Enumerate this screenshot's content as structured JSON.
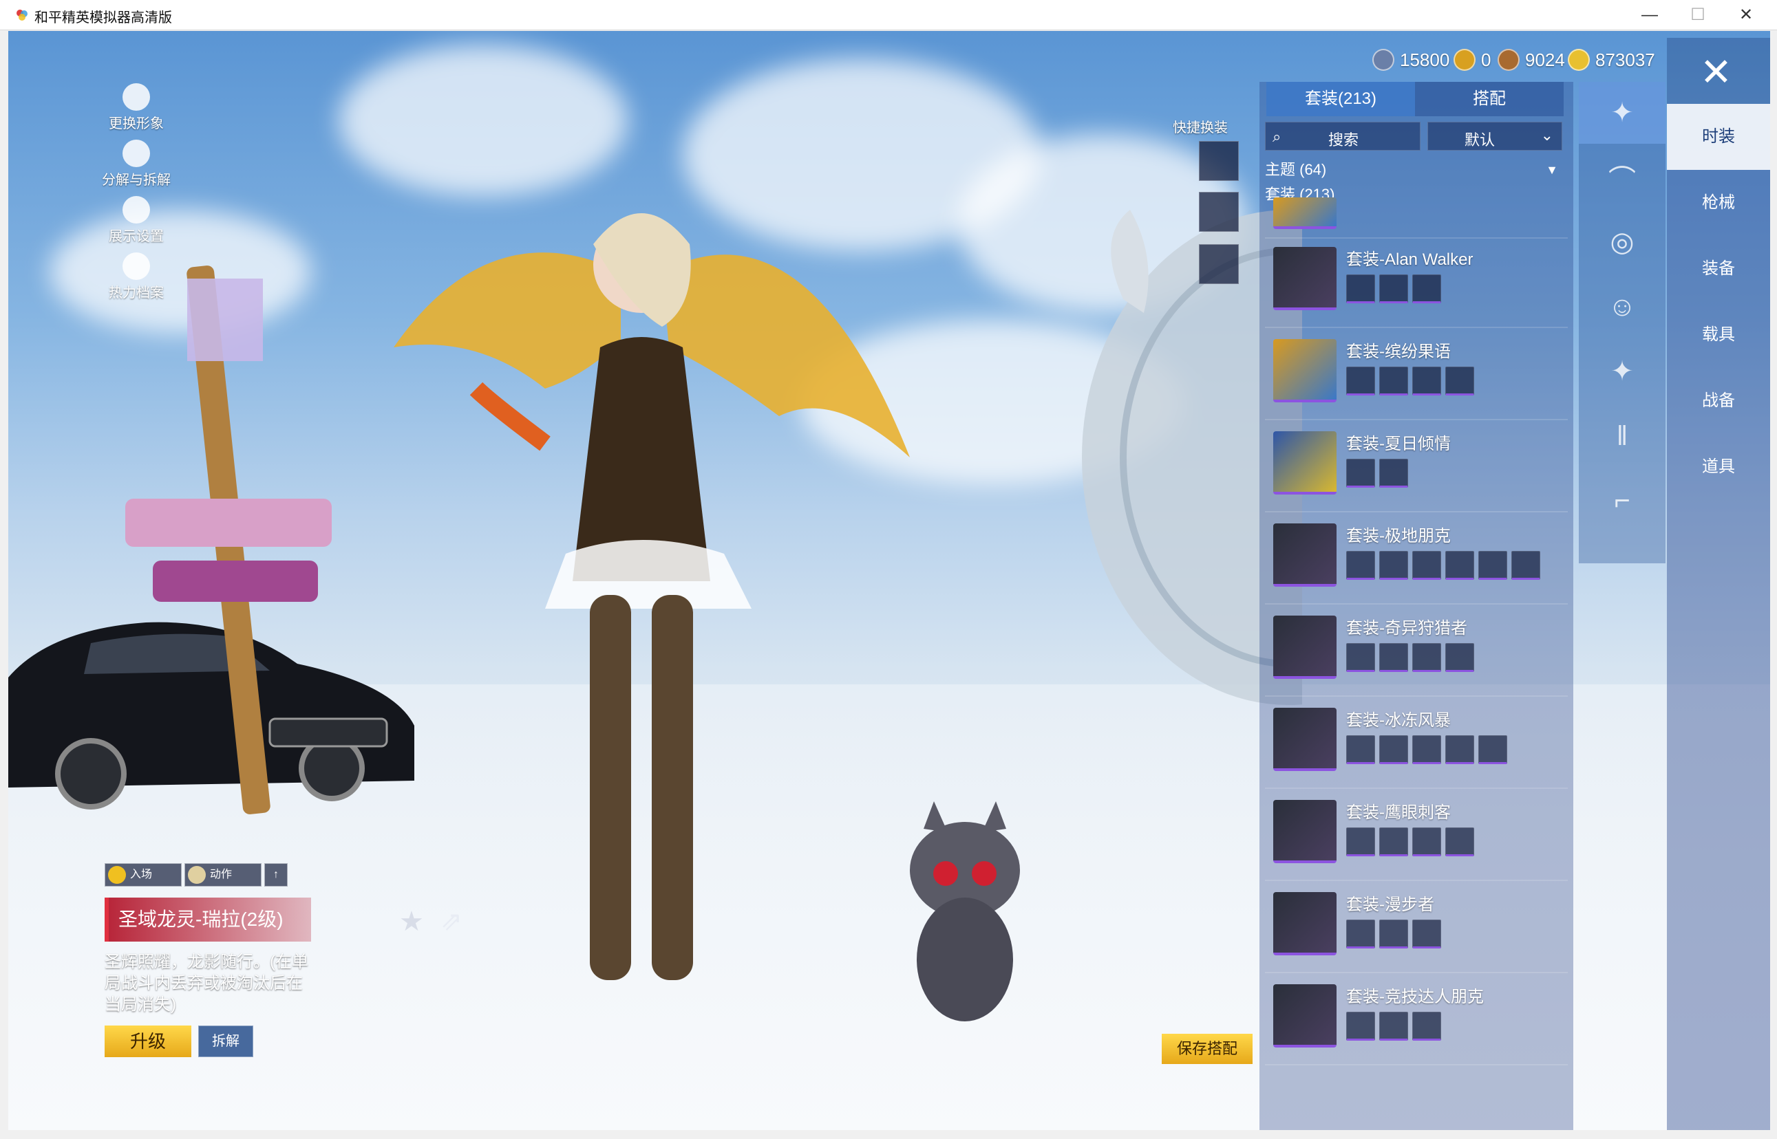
{
  "window": {
    "title": "和平精英模拟器高清版",
    "minimize": "—",
    "maximize": "☐",
    "close": "✕"
  },
  "currency": [
    {
      "icon": "silver-coin-icon",
      "value": "15800"
    },
    {
      "icon": "gold-coin-icon",
      "value": "0"
    },
    {
      "icon": "bronze-coin-icon",
      "value": "9024"
    },
    {
      "icon": "diamond-coin-icon",
      "value": "873037"
    }
  ],
  "close_label": "✕",
  "categories": [
    "时装",
    "枪械",
    "装备",
    "载具",
    "战备",
    "道具"
  ],
  "subnav_glyphs": [
    "✦",
    "⌒",
    "◎",
    "☺",
    "✦",
    "‖",
    "⌐"
  ],
  "panel": {
    "tab_suits": "套装(213)",
    "tab_match": "搭配",
    "search_placeholder": "搜索",
    "sort_label": "默认",
    "group_theme": "主题 (64)",
    "group_suits": "套装 (213)",
    "entries": [
      {
        "name": "套装-Alan Walker",
        "pieces": 3
      },
      {
        "name": "套装-缤纷果语",
        "pieces": 4
      },
      {
        "name": "套装-夏日倾情",
        "pieces": 2
      },
      {
        "name": "套装-极地朋克",
        "pieces": 6
      },
      {
        "name": "套装-奇异狩猎者",
        "pieces": 4
      },
      {
        "name": "套装-冰冻风暴",
        "pieces": 5
      },
      {
        "name": "套装-鹰眼刺客",
        "pieces": 4
      },
      {
        "name": "套装-漫步者",
        "pieces": 3
      },
      {
        "name": "套装-竞技达人朋克",
        "pieces": 3
      }
    ]
  },
  "left_actions": [
    {
      "label": "更换形象",
      "icon": "avatar-icon"
    },
    {
      "label": "分解与拆解",
      "icon": "gear-icon"
    },
    {
      "label": "展示设置",
      "icon": "eye-icon"
    },
    {
      "label": "热力档案",
      "icon": "flame-icon"
    }
  ],
  "quick_change_label": "快捷换装",
  "buttons": {
    "entrance": "入场",
    "action": "动作",
    "upgrade": "升级",
    "dismantle": "拆解",
    "save": "保存搭配",
    "arrow": "↑"
  },
  "item": {
    "name": "圣域龙灵-瑞拉(2级)",
    "description": "圣辉照耀，龙影随行。(在单局战斗内丢弃或被淘汰后在当局消失)"
  }
}
